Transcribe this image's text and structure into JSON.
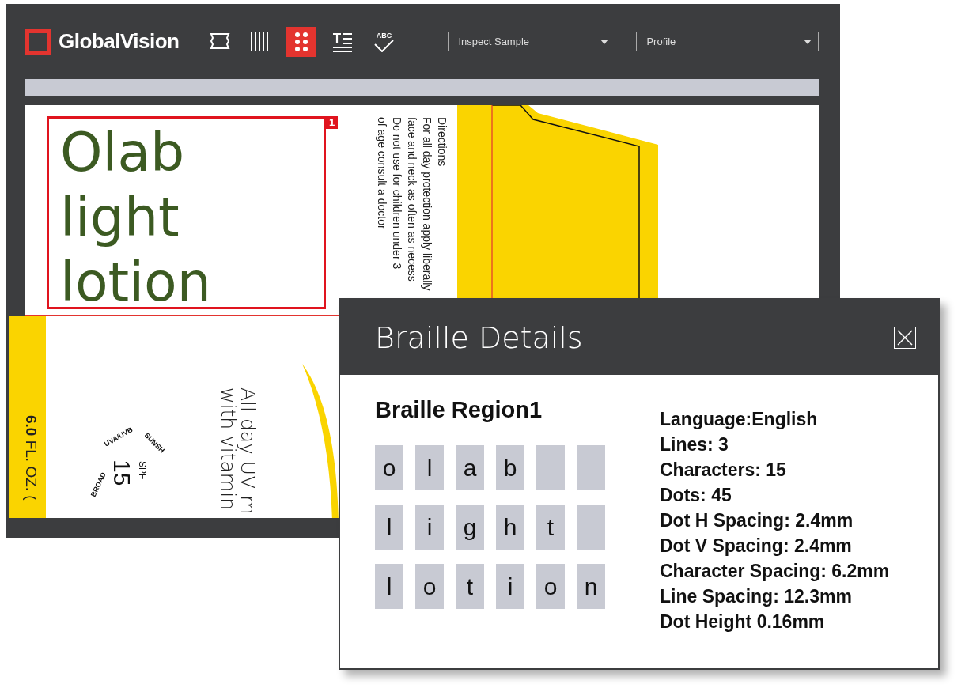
{
  "app": {
    "logo": "GlobalVision",
    "tools": [
      {
        "kind": "label",
        "selected": false
      },
      {
        "kind": "barcode",
        "selected": false
      },
      {
        "kind": "braille",
        "selected": true
      },
      {
        "kind": "text",
        "selected": false
      },
      {
        "kind": "spelling",
        "label": "ABC",
        "selected": false
      }
    ],
    "dropdowns": [
      {
        "value": "Inspect Sample"
      },
      {
        "value": "Profile"
      }
    ]
  },
  "artwork": {
    "region": {
      "badge": "1",
      "lines": [
        "Olab",
        "light",
        "lotion"
      ]
    },
    "directions": [
      "Directions",
      "For all day protection apply liberally",
      "face and neck as often as necess",
      "Do not use for children under 3",
      "of age consult a doctor"
    ],
    "volume": "**6.0** FL. OZ. (",
    "tagline": [
      "All day UV m",
      "with vitamin"
    ],
    "seal": {
      "top_left": "UVA/UVB",
      "left": "BROAD",
      "top_right": "SUNSH",
      "spf": "SPF",
      "number": "15"
    }
  },
  "dialog": {
    "title": "Braille Details",
    "region_title": "Braille Region1",
    "rows": [
      [
        "o",
        "l",
        "a",
        "b"
      ],
      [
        "l",
        "i",
        "g",
        "h",
        "t"
      ],
      [
        "l",
        "o",
        "t",
        "i",
        "o",
        "n"
      ]
    ],
    "details": [
      "Language:English",
      "Lines: 3",
      "Characters: 15",
      "Dots: 45",
      "Dot H Spacing: 2.4mm",
      "Dot V Spacing: 2.4mm",
      "Character Spacing: 6.2mm",
      "Line Spacing: 12.3mm",
      "Dot Height 0.16mm"
    ]
  }
}
